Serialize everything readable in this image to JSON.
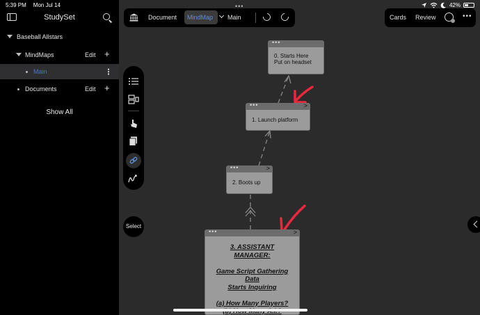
{
  "status": {
    "time": "5:39 PM",
    "date": "Mon Jul 14",
    "battery": "42%"
  },
  "sidebar": {
    "title": "StudySet",
    "project": "Baseball Allstars",
    "mindmaps": {
      "label": "MindMaps",
      "edit": "Edit",
      "add": "+"
    },
    "main_item": "Main",
    "documents": {
      "label": "Documents",
      "edit": "Edit",
      "add": "+"
    },
    "show_all": "Show All"
  },
  "toolbar": {
    "document": "Document",
    "mindmap": "MindMap",
    "current_map": "Main",
    "cards": "Cards",
    "review": "Review"
  },
  "palette": {
    "select": "Select"
  },
  "nodes": {
    "n0": {
      "line1": "0. Starts Here",
      "line2": "Put on headset"
    },
    "n1": {
      "text": "1. Launch platform"
    },
    "n2": {
      "text": "2. Boots up"
    },
    "n3": {
      "line1": "3. ASSISTANT",
      "line2": "MANAGER:",
      "line3": "Game Script Gathering",
      "line4": "Data",
      "line5": "Starts Inquiring",
      "line6": "(a) How Many Players?",
      "line7": "(b) How Many A.I.?"
    }
  },
  "colors": {
    "accent": "#4a78c8",
    "annotation": "#e8283c",
    "node": "#9b9b9b"
  }
}
